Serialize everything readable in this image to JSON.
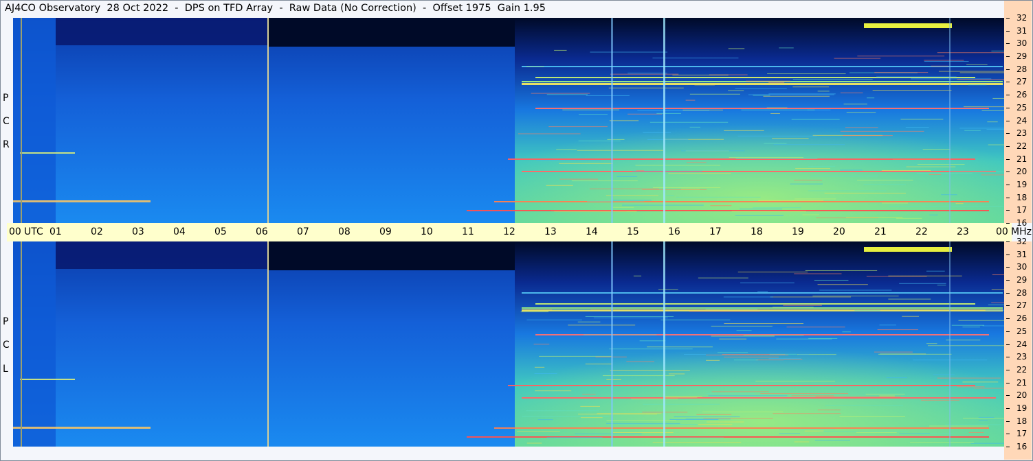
{
  "title": "AJ4CO Observatory  28 Oct 2022  -  DPS on TFD Array  -  Raw Data (No Correction)  -  Offset 1975  Gain 1.95",
  "time_axis": {
    "labels": [
      "00",
      "UTC",
      "01",
      "02",
      "03",
      "04",
      "05",
      "06",
      "07",
      "08",
      "09",
      "10",
      "11",
      "12",
      "13",
      "14",
      "15",
      "16",
      "17",
      "18",
      "19",
      "20",
      "21",
      "22",
      "23",
      "00",
      "MHz"
    ]
  },
  "panels": [
    {
      "id": "rcp",
      "side_letters": [
        "P",
        "C",
        "R"
      ]
    },
    {
      "id": "lcp",
      "side_letters": [
        "P",
        "C",
        "L"
      ]
    }
  ],
  "freq_axis": {
    "labels": [
      "32",
      "31",
      "30",
      "29",
      "28",
      "27",
      "26",
      "25",
      "24",
      "23",
      "22",
      "21",
      "20",
      "19",
      "18",
      "17",
      "16"
    ]
  },
  "colors": {
    "low": "#000a28",
    "mid": "#1e78e6",
    "high": "#50d8b4",
    "peak": "#fff03c",
    "hot": "#ff5050",
    "strip": "#ffffcc",
    "freq_column": "#ffd8b8",
    "marker": "#c8c864"
  },
  "chart_data": {
    "type": "heatmap",
    "title": "AJ4CO Observatory  28 Oct 2022  -  DPS on TFD Array  -  Raw Data (No Correction)  -  Offset 1975  Gain 1.95",
    "x_range": [
      "00 UTC",
      "00 UTC"
    ],
    "y_range_mhz": [
      16,
      32
    ],
    "panels": [
      "RCP",
      "LCP"
    ],
    "time_markers_utc": [
      "00:12",
      "06:10"
    ],
    "notes": "Spectrogram intensity rises after ~12 UTC, bright band near 27 MHz and 25 MHz, horizontal interference lines at 17, 20, 21, 25, 27 MHz"
  }
}
